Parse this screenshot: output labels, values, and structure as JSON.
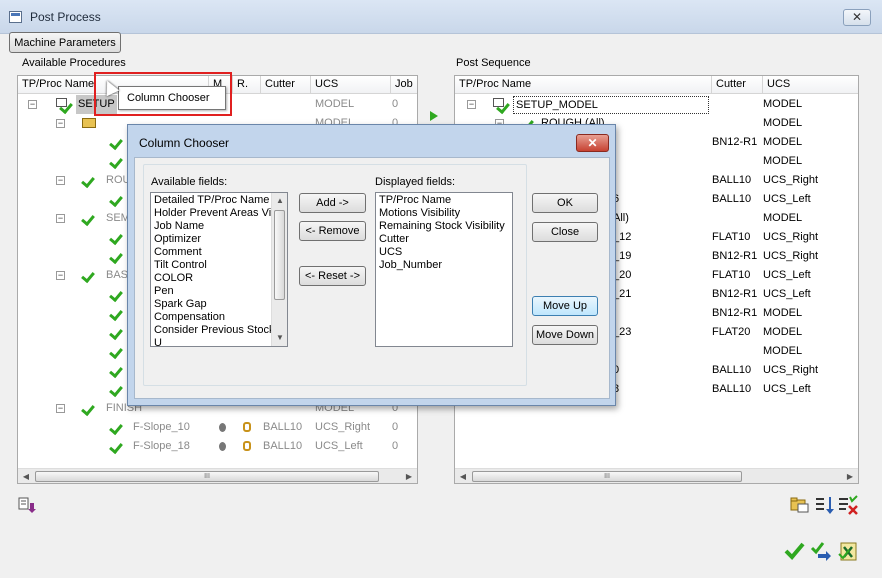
{
  "window": {
    "title": "Post Process",
    "close_glyph": "✕"
  },
  "toolbar": {
    "machine_params_label": "Machine Parameters"
  },
  "left": {
    "section_label": "Available Procedures",
    "headers": [
      "TP/Proc Name",
      "M",
      "R.",
      "Cutter",
      "UCS",
      "Job"
    ],
    "tooltip": "Column Chooser",
    "rows": [
      {
        "name": "SETUP",
        "ucs": "MODEL",
        "job": "0",
        "level": 0,
        "selected": true
      },
      {
        "name": "",
        "ucs": "MODEL",
        "job": "0",
        "level": 1
      },
      {
        "name": "",
        "ucs": "",
        "job": "",
        "level": 2
      },
      {
        "name": "",
        "ucs": "",
        "job": "",
        "level": 2
      },
      {
        "name": "ROU",
        "ucs": "",
        "job": "",
        "level": 1
      },
      {
        "name": "",
        "ucs": "",
        "job": "",
        "level": 2
      },
      {
        "name": "SEM",
        "ucs": "",
        "job": "",
        "level": 1
      },
      {
        "name": "",
        "ucs": "",
        "job": "",
        "level": 2
      },
      {
        "name": "",
        "ucs": "",
        "job": "",
        "level": 2
      },
      {
        "name": "BASE",
        "ucs": "",
        "job": "",
        "level": 1
      },
      {
        "name": "",
        "ucs": "",
        "job": "",
        "level": 2
      },
      {
        "name": "",
        "ucs": "",
        "job": "",
        "level": 2
      },
      {
        "name": "",
        "ucs": "",
        "job": "",
        "level": 2
      },
      {
        "name": "",
        "ucs": "",
        "job": "",
        "level": 2
      },
      {
        "name": "",
        "ucs": "",
        "job": "",
        "level": 2
      },
      {
        "name": "",
        "ucs": "",
        "job": "",
        "level": 2
      },
      {
        "name": "FINISH",
        "cutter": "",
        "ucs": "MODEL",
        "job": "0",
        "level": 1
      },
      {
        "name": "F-Slope_10",
        "cutter": "BALL10",
        "ucs": "UCS_Right",
        "job": "0",
        "level": 2
      },
      {
        "name": "F-Slope_18",
        "cutter": "BALL10",
        "ucs": "UCS_Left",
        "job": "0",
        "level": 2
      }
    ]
  },
  "right": {
    "section_label": "Post Sequence",
    "headers": [
      "TP/Proc Name",
      "Cutter",
      "UCS"
    ],
    "rows": [
      {
        "name": "SETUP_MODEL",
        "cutter": "",
        "ucs": "MODEL"
      },
      {
        "name": "ROUGH (All)",
        "cutter": "",
        "ucs": "MODEL"
      },
      {
        "name": "",
        "cutter": "BN12-R1",
        "ucs": "MODEL"
      },
      {
        "name": "",
        "cutter": "",
        "ucs": "MODEL"
      },
      {
        "name": "",
        "cutter": "BALL10",
        "ucs": "UCS_Right"
      },
      {
        "name": "6",
        "cutter": "BALL10",
        "ucs": "UCS_Left"
      },
      {
        "name": "All)",
        "cutter": "",
        "ucs": "MODEL"
      },
      {
        "name": "_12",
        "cutter": "FLAT10",
        "ucs": "UCS_Right"
      },
      {
        "name": "_19",
        "cutter": "BN12-R1",
        "ucs": "UCS_Right"
      },
      {
        "name": "_20",
        "cutter": "FLAT10",
        "ucs": "UCS_Left"
      },
      {
        "name": "_21",
        "cutter": "BN12-R1",
        "ucs": "UCS_Left"
      },
      {
        "name": "",
        "cutter": "BN12-R1",
        "ucs": "MODEL"
      },
      {
        "name": "_23",
        "cutter": "FLAT20",
        "ucs": "MODEL"
      },
      {
        "name": "",
        "cutter": "",
        "ucs": "MODEL"
      },
      {
        "name": "0",
        "cutter": "BALL10",
        "ucs": "UCS_Right"
      },
      {
        "name": "8",
        "cutter": "BALL10",
        "ucs": "UCS_Left"
      }
    ]
  },
  "scroll": {
    "thumb_glyph": "III"
  },
  "dialog": {
    "title": "Column Chooser",
    "close_glyph": "✕",
    "available_label": "Available fields:",
    "displayed_label": "Displayed fields:",
    "available_fields": [
      "Detailed TP/Proc Name",
      "Holder Prevent Areas Vis",
      "Job Name",
      "Optimizer",
      "Comment",
      "Tilt Control",
      "COLOR",
      "Pen",
      "Spark Gap",
      "Compensation",
      "Consider Previous Stock",
      "U"
    ],
    "displayed_fields": [
      "TP/Proc Name",
      "Motions Visibility",
      "Remaining Stock Visibility",
      "Cutter",
      "UCS",
      "Job_Number"
    ],
    "add_label": "Add ->",
    "remove_label": "<- Remove",
    "reset_label": "<- Reset ->",
    "ok_label": "OK",
    "close_label": "Close",
    "moveup_label": "Move Up",
    "movedown_label": "Move Down"
  },
  "colors": {
    "accent": "#2fa820",
    "highlight": "#e02020",
    "selection": "#c7c7c7"
  }
}
